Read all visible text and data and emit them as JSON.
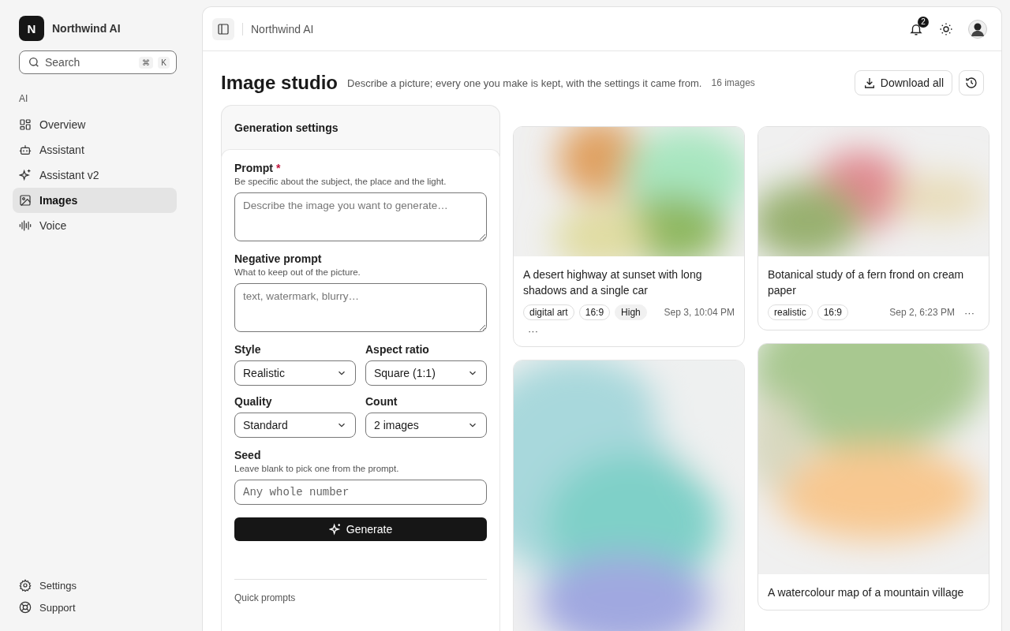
{
  "brand": {
    "initial": "N",
    "name": "Northwind AI"
  },
  "search": {
    "placeholder": "Search",
    "keys": [
      "⌘",
      "K"
    ]
  },
  "sidebar": {
    "section": "AI",
    "items": [
      {
        "label": "Overview",
        "selected": false
      },
      {
        "label": "Assistant",
        "selected": false
      },
      {
        "label": "Assistant v2",
        "selected": false
      },
      {
        "label": "Images",
        "selected": true
      },
      {
        "label": "Voice",
        "selected": false
      }
    ],
    "footer": [
      {
        "label": "Settings"
      },
      {
        "label": "Support"
      }
    ]
  },
  "topbar": {
    "breadcrumb": "Northwind AI",
    "notifications": "2"
  },
  "page": {
    "title": "Image studio",
    "subtitle": "Describe a picture; every one you make is kept, with the settings it came from.",
    "count": "16 images",
    "download": "Download all"
  },
  "settings": {
    "title": "Generation settings",
    "prompt": {
      "label": "Prompt",
      "required_mark": "*",
      "hint": "Be specific about the subject, the place and the light.",
      "placeholder": "Describe the image you want to generate…"
    },
    "negative": {
      "label": "Negative prompt",
      "hint": "What to keep out of the picture.",
      "placeholder": "text, watermark, blurry…"
    },
    "selects": [
      {
        "label": "Style",
        "value": "Realistic"
      },
      {
        "label": "Aspect ratio",
        "value": "Square (1:1)"
      },
      {
        "label": "Quality",
        "value": "Standard"
      },
      {
        "label": "Count",
        "value": "2 images"
      }
    ],
    "seed": {
      "label": "Seed",
      "hint": "Leave blank to pick one from the prompt.",
      "placeholder": "Any whole number"
    },
    "generate": "Generate",
    "quick_prompts": "Quick prompts"
  },
  "gallery": [
    [
      {
        "title": "A desert highway at sunset with long shadows and a single car",
        "tags": [
          {
            "label": "digital art",
            "kind": "outline"
          },
          {
            "label": "16:9",
            "kind": "outline"
          },
          {
            "label": "High",
            "kind": "filled"
          }
        ],
        "date": "Sep 3, 10:04 PM",
        "more": "···"
      },
      {
        "kind": "picture"
      }
    ],
    [
      {
        "title": "Botanical study of a fern frond on cream paper",
        "tags": [
          {
            "label": "realistic",
            "kind": "outline"
          },
          {
            "label": "16:9",
            "kind": "outline"
          }
        ],
        "date": "Sep 2, 6:23 PM",
        "more": "···"
      },
      {
        "title": "A watercolour map of a mountain village"
      }
    ]
  ]
}
